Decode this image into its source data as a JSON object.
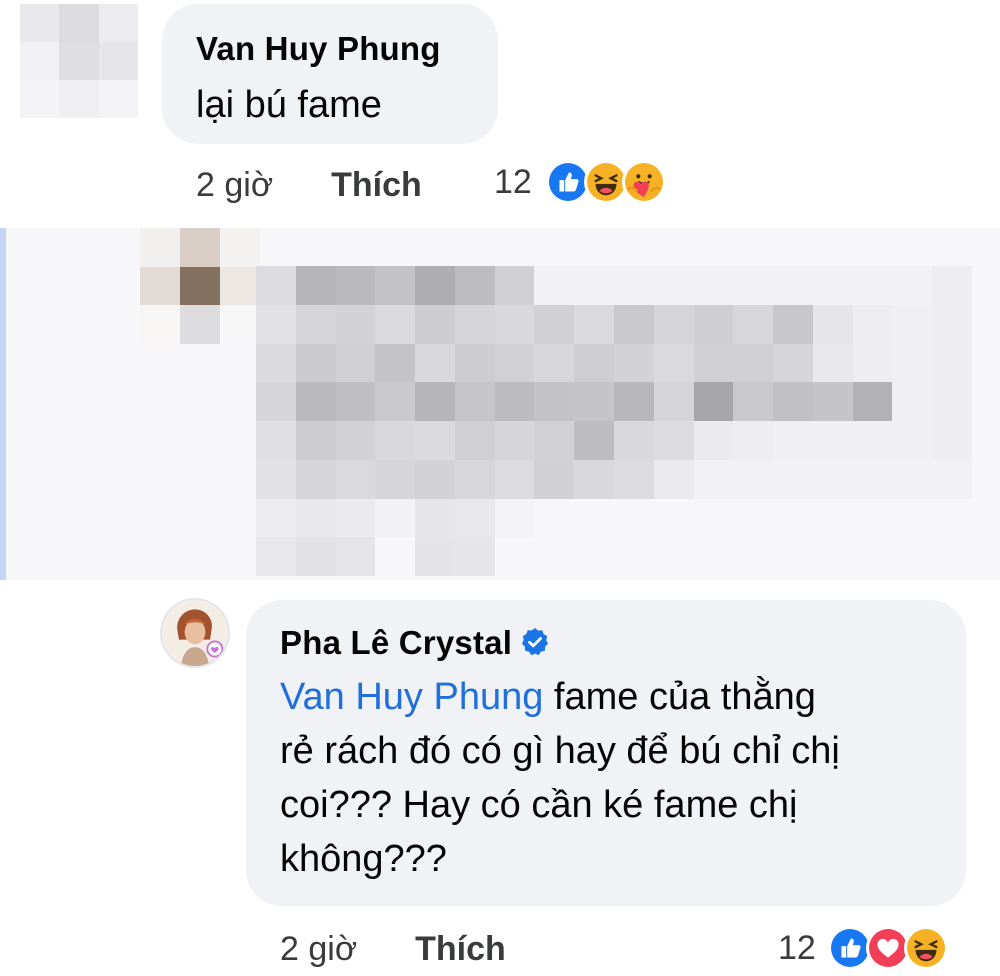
{
  "comments": [
    {
      "author": "Van Huy Phung",
      "text": "lại bú fame",
      "time": "2 giờ",
      "like_label": "Thích",
      "reaction_count": "12",
      "reactions": [
        "like-icon",
        "haha-icon",
        "care-icon"
      ]
    },
    {
      "author": "Pha Lê Crystal",
      "verified": true,
      "mention": "Van Huy Phung",
      "text_lines": [
        " fame của thằng",
        "rẻ rách đó có gì hay để bú chỉ chị",
        "coi??? Hay có cần ké fame chị",
        "không???"
      ],
      "time": "2 giờ",
      "like_label": "Thích",
      "reaction_count": "12",
      "reactions": [
        "like-icon",
        "love-icon",
        "haha-icon"
      ]
    }
  ],
  "colors": {
    "bubble": "#f0f2f5",
    "mention": "#216fdb",
    "like_blue": "#1877f2",
    "love_red": "#f33e58",
    "haha_yellow": "#f7b125",
    "thread_line": "#c5d5f5"
  }
}
